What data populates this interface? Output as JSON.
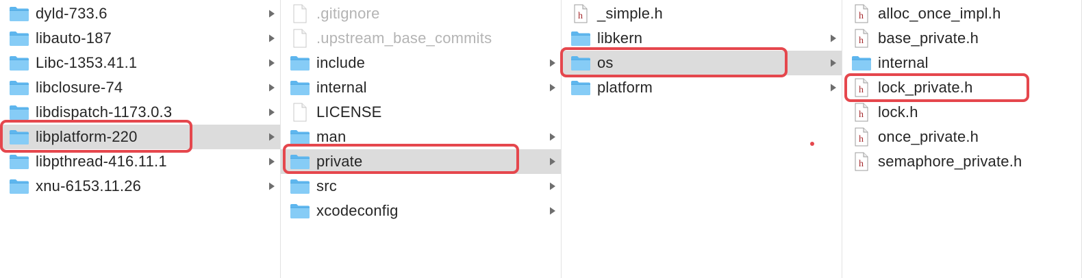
{
  "columns": [
    {
      "items": [
        {
          "label": "dyld-733.6",
          "kind": "folder",
          "chevron": true
        },
        {
          "label": "libauto-187",
          "kind": "folder",
          "chevron": true
        },
        {
          "label": "Libc-1353.41.1",
          "kind": "folder",
          "chevron": true
        },
        {
          "label": "libclosure-74",
          "kind": "folder",
          "chevron": true
        },
        {
          "label": "libdispatch-1173.0.3",
          "kind": "folder",
          "chevron": true
        },
        {
          "label": "libplatform-220",
          "kind": "folder",
          "chevron": true,
          "selected": true,
          "highlighted": true
        },
        {
          "label": "libpthread-416.11.1",
          "kind": "folder",
          "chevron": true
        },
        {
          "label": "xnu-6153.11.26",
          "kind": "folder",
          "chevron": true
        }
      ]
    },
    {
      "items": [
        {
          "label": ".gitignore",
          "kind": "document",
          "dim": true
        },
        {
          "label": ".upstream_base_commits",
          "kind": "document",
          "dim": true
        },
        {
          "label": "include",
          "kind": "folder",
          "chevron": true
        },
        {
          "label": "internal",
          "kind": "folder",
          "chevron": true
        },
        {
          "label": "LICENSE",
          "kind": "document"
        },
        {
          "label": "man",
          "kind": "folder",
          "chevron": true
        },
        {
          "label": "private",
          "kind": "folder",
          "chevron": true,
          "selected": true,
          "highlighted": true
        },
        {
          "label": "src",
          "kind": "folder",
          "chevron": true
        },
        {
          "label": "xcodeconfig",
          "kind": "folder",
          "chevron": true
        }
      ]
    },
    {
      "items": [
        {
          "label": "_simple.h",
          "kind": "header"
        },
        {
          "label": "libkern",
          "kind": "folder",
          "chevron": true
        },
        {
          "label": "os",
          "kind": "folder",
          "chevron": true,
          "selected": true,
          "highlighted": true
        },
        {
          "label": "platform",
          "kind": "folder",
          "chevron": true
        }
      ]
    },
    {
      "items": [
        {
          "label": "alloc_once_impl.h",
          "kind": "header"
        },
        {
          "label": "base_private.h",
          "kind": "header"
        },
        {
          "label": "internal",
          "kind": "folder"
        },
        {
          "label": "lock_private.h",
          "kind": "header",
          "highlighted": true
        },
        {
          "label": "lock.h",
          "kind": "header"
        },
        {
          "label": "once_private.h",
          "kind": "header"
        },
        {
          "label": "semaphore_private.h",
          "kind": "header"
        }
      ]
    }
  ],
  "colors": {
    "selection_bg": "#dcdcdc",
    "highlight_border": "#e5474d",
    "folder_fill": "#74c3f2",
    "header_glyph": "#a3262a",
    "dim_text": "#b4b4b4"
  }
}
